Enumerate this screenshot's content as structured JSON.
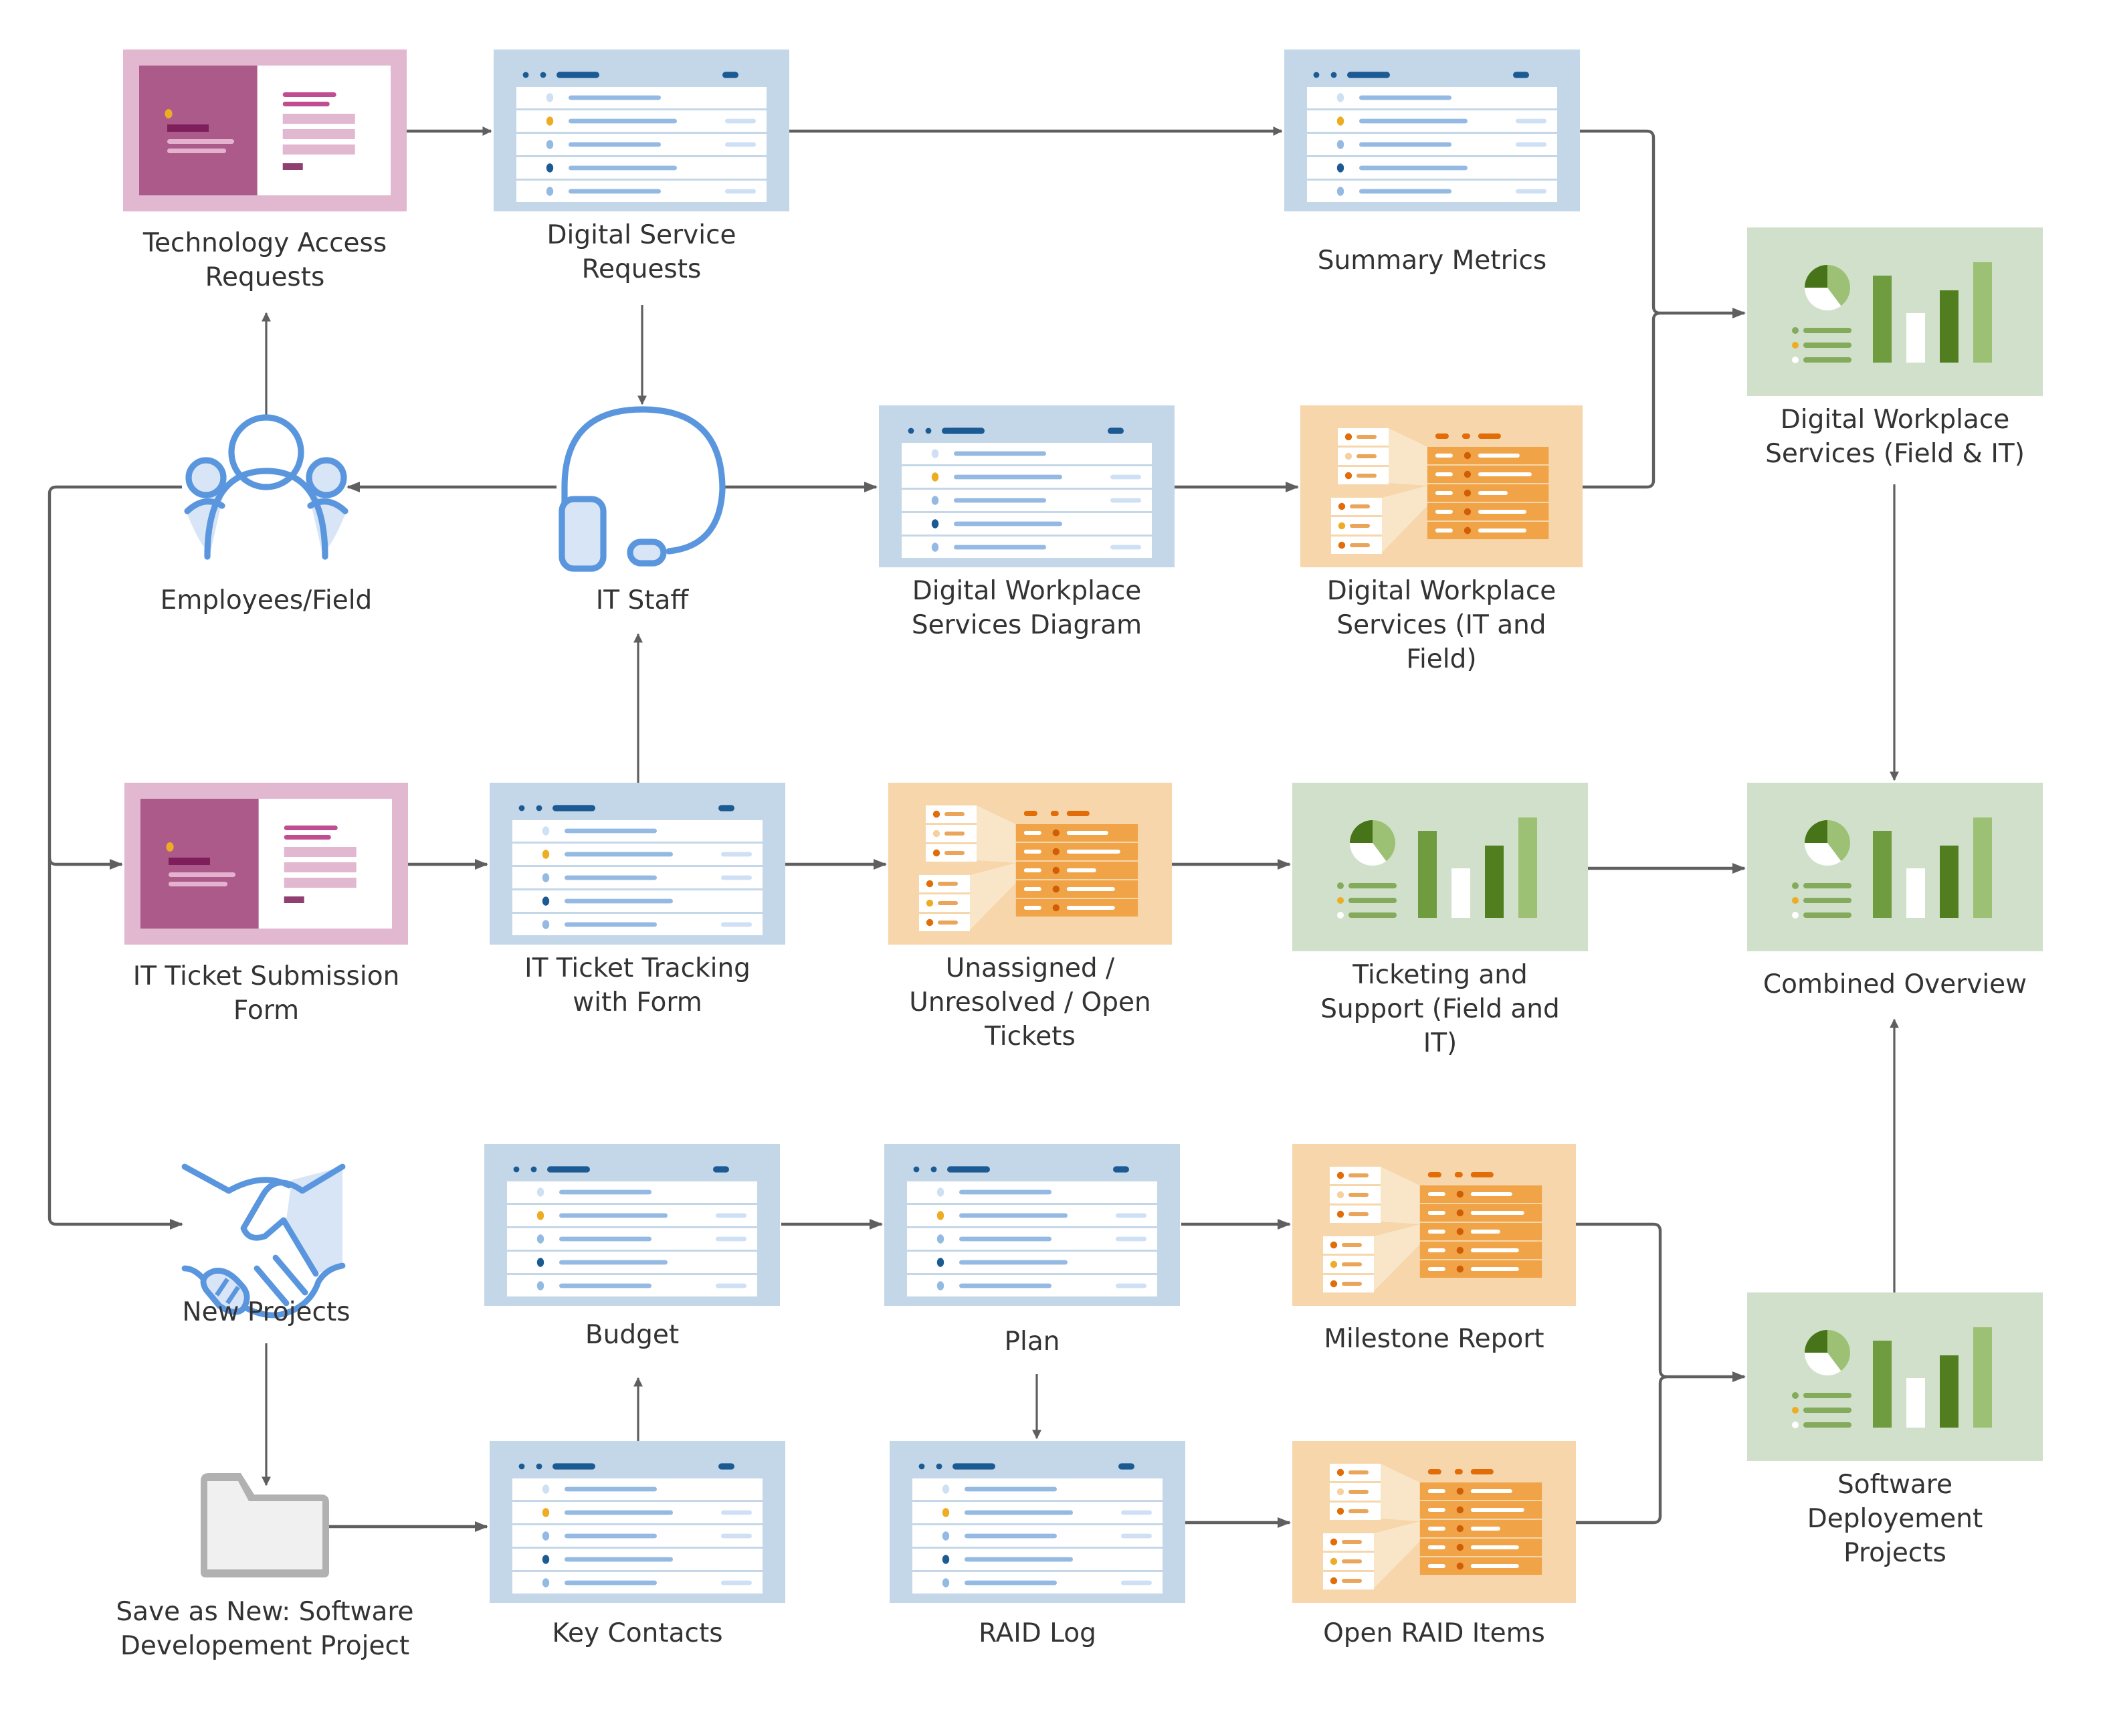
{
  "diagram": {
    "colors": {
      "connector": "#5f5f5f",
      "label_text": "#333333",
      "form_bg": "#e2b7d0",
      "form_panel": "#ab5a8a",
      "sheet_bg": "#c3d7e8",
      "sheet_accent": "#1b5a92",
      "report_bg": "#f6d6aa",
      "report_accent": "#f0a347",
      "dashboard_bg": "#d0e0ca",
      "dashboard_dark": "#4e7d22",
      "icon_blue": "#5a96de",
      "icon_fill": "#d8e5f6",
      "highlight_dot": "#ecad25"
    },
    "nodes": [
      {
        "id": "tech-access",
        "type": "form",
        "label": [
          "Technology Access",
          "Requests"
        ]
      },
      {
        "id": "digital-service",
        "type": "sheet",
        "label": [
          "Digital Service",
          "Requests"
        ]
      },
      {
        "id": "summary-metrics",
        "type": "sheet",
        "label": [
          "Summary Metrics"
        ]
      },
      {
        "id": "dws-field-it",
        "type": "dashboard",
        "label": [
          "Digital Workplace",
          "Services (Field & IT)"
        ]
      },
      {
        "id": "employees",
        "type": "people-icon",
        "label": [
          "Employees/Field"
        ]
      },
      {
        "id": "it-staff",
        "type": "headset-icon",
        "label": [
          "IT Staff"
        ]
      },
      {
        "id": "dws-diagram",
        "type": "sheet",
        "label": [
          "Digital Workplace",
          "Services Diagram"
        ]
      },
      {
        "id": "dws-it-field",
        "type": "report",
        "label": [
          "Digital Workplace",
          "Services (IT and",
          "Field)"
        ]
      },
      {
        "id": "ticket-form",
        "type": "form",
        "label": [
          "IT Ticket Submission",
          "Form"
        ]
      },
      {
        "id": "ticket-tracking",
        "type": "sheet",
        "label": [
          "IT Ticket Tracking",
          "with Form"
        ]
      },
      {
        "id": "open-tickets",
        "type": "report",
        "label": [
          "Unassigned /",
          "Unresolved / Open",
          "Tickets"
        ]
      },
      {
        "id": "ticketing-support",
        "type": "dashboard",
        "label": [
          "Ticketing and",
          "Support (Field and",
          "IT)"
        ]
      },
      {
        "id": "combined-overview",
        "type": "dashboard",
        "label": [
          "Combined Overview"
        ]
      },
      {
        "id": "new-projects",
        "type": "handshake-icon",
        "label": [
          "New Projects"
        ]
      },
      {
        "id": "budget",
        "type": "sheet",
        "label": [
          "Budget"
        ]
      },
      {
        "id": "plan",
        "type": "sheet",
        "label": [
          "Plan"
        ]
      },
      {
        "id": "milestone-report",
        "type": "report",
        "label": [
          "Milestone Report"
        ]
      },
      {
        "id": "software-deployment",
        "type": "dashboard",
        "label": [
          "Software",
          "Deployement",
          "Projects"
        ]
      },
      {
        "id": "save-as-new",
        "type": "folder-icon",
        "label": [
          "Save as New: Software",
          "Developement Project"
        ]
      },
      {
        "id": "key-contacts",
        "type": "sheet",
        "label": [
          "Key Contacts"
        ]
      },
      {
        "id": "raid-log",
        "type": "sheet",
        "label": [
          "RAID Log"
        ]
      },
      {
        "id": "open-raid",
        "type": "report",
        "label": [
          "Open RAID Items"
        ]
      }
    ],
    "edges": [
      {
        "from": "tech-access",
        "to": "digital-service"
      },
      {
        "from": "digital-service",
        "to": "summary-metrics"
      },
      {
        "from": "digital-service",
        "to": "it-staff"
      },
      {
        "from": "summary-metrics",
        "to": "dws-field-it"
      },
      {
        "from": "dws-it-field",
        "to": "dws-field-it"
      },
      {
        "from": "employees",
        "to": "tech-access"
      },
      {
        "from": "it-staff",
        "to": "employees"
      },
      {
        "from": "it-staff",
        "to": "dws-diagram"
      },
      {
        "from": "dws-diagram",
        "to": "dws-it-field"
      },
      {
        "from": "employees",
        "to": "ticket-form"
      },
      {
        "from": "employees",
        "to": "new-projects"
      },
      {
        "from": "ticket-form",
        "to": "ticket-tracking"
      },
      {
        "from": "ticket-tracking",
        "to": "it-staff"
      },
      {
        "from": "ticket-tracking",
        "to": "open-tickets"
      },
      {
        "from": "open-tickets",
        "to": "ticketing-support"
      },
      {
        "from": "ticketing-support",
        "to": "combined-overview"
      },
      {
        "from": "dws-field-it",
        "to": "combined-overview"
      },
      {
        "from": "software-deployment",
        "to": "combined-overview"
      },
      {
        "from": "new-projects",
        "to": "save-as-new"
      },
      {
        "from": "save-as-new",
        "to": "key-contacts"
      },
      {
        "from": "key-contacts",
        "to": "budget"
      },
      {
        "from": "budget",
        "to": "plan"
      },
      {
        "from": "plan",
        "to": "milestone-report"
      },
      {
        "from": "plan",
        "to": "raid-log"
      },
      {
        "from": "raid-log",
        "to": "open-raid"
      },
      {
        "from": "milestone-report",
        "to": "software-deployment"
      },
      {
        "from": "open-raid",
        "to": "software-deployment"
      }
    ]
  }
}
